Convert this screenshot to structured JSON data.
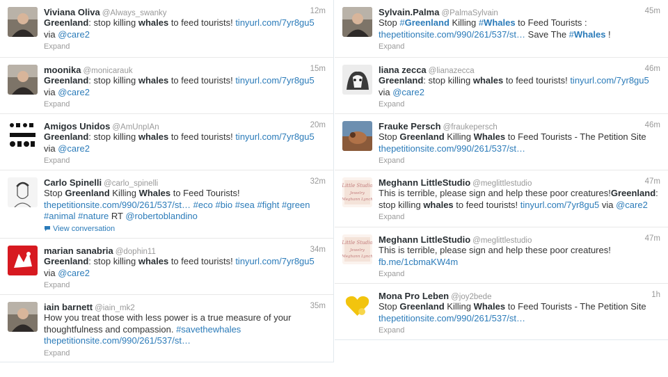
{
  "colors": {
    "link": "#2b7bb9",
    "muted": "#999999",
    "text": "#333333",
    "name": "#292f33",
    "divider": "#e8e8e8"
  },
  "left": [
    {
      "name": "Viviana Oliva",
      "handle": "@Always_swanky",
      "time": "12m",
      "avatar_icon": "photo-person-icon",
      "segments": [
        {
          "t": "Greenland",
          "b": true
        },
        {
          "t": ": stop killing "
        },
        {
          "t": "whales",
          "b": true
        },
        {
          "t": " to feed tourists! "
        },
        {
          "t": "tinyurl.com/7yr8gu5",
          "l": true
        },
        {
          "t": " via "
        },
        {
          "t": "@care2",
          "l": true
        }
      ],
      "action": "Expand"
    },
    {
      "name": "moonika",
      "handle": "@monicarauk",
      "time": "15m",
      "avatar_icon": "photo-person-icon",
      "segments": [
        {
          "t": "Greenland",
          "b": true
        },
        {
          "t": ": stop killing "
        },
        {
          "t": "whales",
          "b": true
        },
        {
          "t": " to feed tourists! "
        },
        {
          "t": "tinyurl.com/7yr8gu5",
          "l": true
        },
        {
          "t": " via "
        },
        {
          "t": "@care2",
          "l": true
        }
      ],
      "action": "Expand"
    },
    {
      "name": "Amigos Unidos",
      "handle": "@AmUnpIAn",
      "time": "20m",
      "avatar_icon": "logo-glyphs-icon",
      "segments": [
        {
          "t": "Greenland",
          "b": true
        },
        {
          "t": ": stop killing "
        },
        {
          "t": "whales",
          "b": true
        },
        {
          "t": " to feed tourists! "
        },
        {
          "t": "tinyurl.com/7yr8gu5",
          "l": true
        },
        {
          "t": " via "
        },
        {
          "t": "@care2",
          "l": true
        }
      ],
      "action": "Expand"
    },
    {
      "name": "Carlo Spinelli",
      "handle": "@carlo_spinelli",
      "time": "32m",
      "avatar_icon": "sketch-face-icon",
      "segments": [
        {
          "t": "Stop "
        },
        {
          "t": "Greenland",
          "b": true
        },
        {
          "t": " Killing "
        },
        {
          "t": "Whales",
          "b": true
        },
        {
          "t": " to Feed Tourists! "
        },
        {
          "t": "thepetitionsite.com/990/261/537/st…",
          "l": true
        },
        {
          "t": " "
        },
        {
          "t": "#eco",
          "l": true
        },
        {
          "t": " "
        },
        {
          "t": "#bio",
          "l": true
        },
        {
          "t": " "
        },
        {
          "t": "#sea",
          "l": true
        },
        {
          "t": " "
        },
        {
          "t": "#fight",
          "l": true
        },
        {
          "t": " "
        },
        {
          "t": "#green",
          "l": true
        },
        {
          "t": " "
        },
        {
          "t": "#animal",
          "l": true
        },
        {
          "t": " "
        },
        {
          "t": "#nature",
          "l": true
        },
        {
          "t": " RT "
        },
        {
          "t": "@robertoblandino",
          "l": true
        }
      ],
      "action": "View conversation",
      "action_link": true
    },
    {
      "name": "marian sanabria",
      "handle": "@dophin11",
      "time": "34m",
      "avatar_icon": "red-logo-icon",
      "segments": [
        {
          "t": "Greenland",
          "b": true
        },
        {
          "t": ": stop killing "
        },
        {
          "t": "whales",
          "b": true
        },
        {
          "t": " to feed tourists! "
        },
        {
          "t": "tinyurl.com/7yr8gu5",
          "l": true
        },
        {
          "t": " via "
        },
        {
          "t": "@care2",
          "l": true
        }
      ],
      "action": "Expand"
    },
    {
      "name": "iain barnett",
      "handle": "@iain_mk2",
      "time": "35m",
      "avatar_icon": "photo-person-icon",
      "segments": [
        {
          "t": "How you treat those with less power is a true measure of your thoughtfulness and compassion. "
        },
        {
          "t": "#savethewhales",
          "l": true
        },
        {
          "t": " "
        },
        {
          "t": "thepetitionsite.com/990/261/537/st…",
          "l": true
        }
      ],
      "action": "Expand"
    }
  ],
  "right": [
    {
      "name": "Sylvain.Palma",
      "handle": "@PalmaSylvain",
      "time": "45m",
      "avatar_icon": "photo-person-icon",
      "segments": [
        {
          "t": "Stop "
        },
        {
          "t": "#",
          "l": true
        },
        {
          "t": "Greenland",
          "l": true,
          "b": true
        },
        {
          "t": " Killing "
        },
        {
          "t": "#",
          "l": true
        },
        {
          "t": "Whales",
          "l": true,
          "b": true
        },
        {
          "t": " to Feed Tourists : "
        },
        {
          "t": "thepetitionsite.com/990/261/537/st…",
          "l": true
        },
        {
          "t": " Save The "
        },
        {
          "t": "#",
          "l": true
        },
        {
          "t": "Whales",
          "l": true,
          "b": true
        },
        {
          "t": " !"
        }
      ],
      "action": "Expand"
    },
    {
      "name": "liana zecca",
      "handle": "@lianazecca",
      "time": "46m",
      "avatar_icon": "photo-dog-icon",
      "segments": [
        {
          "t": "Greenland",
          "b": true
        },
        {
          "t": ": stop killing "
        },
        {
          "t": "whales",
          "b": true
        },
        {
          "t": " to feed tourists! "
        },
        {
          "t": "tinyurl.com/7yr8gu5",
          "l": true
        },
        {
          "t": " via "
        },
        {
          "t": "@care2",
          "l": true
        }
      ],
      "action": "Expand"
    },
    {
      "name": "Frauke Persch",
      "handle": "@fraukepersch",
      "time": "46m",
      "avatar_icon": "photo-animal-icon",
      "segments": [
        {
          "t": "Stop "
        },
        {
          "t": "Greenland",
          "b": true
        },
        {
          "t": " Killing "
        },
        {
          "t": "Whales",
          "b": true
        },
        {
          "t": " to Feed Tourists - The Petition Site "
        },
        {
          "t": "thepetitionsite.com/990/261/537/st…",
          "l": true
        }
      ],
      "action": "Expand"
    },
    {
      "name": "Meghann LittleStudio",
      "handle": "@meglittlestudio",
      "time": "47m",
      "avatar_icon": "studio-logo-icon",
      "avatar_lines": [
        "Little Studio",
        "Jewelry",
        "Meghann Lynch"
      ],
      "segments": [
        {
          "t": "This is terrible, please sign and help these poor creatures!"
        },
        {
          "t": "Greenland",
          "b": true
        },
        {
          "t": ": stop killing "
        },
        {
          "t": "whales",
          "b": true
        },
        {
          "t": " to feed tourists! "
        },
        {
          "t": "tinyurl.com/7yr8gu5",
          "l": true
        },
        {
          "t": " via "
        },
        {
          "t": "@care2",
          "l": true
        }
      ],
      "action": "Expand"
    },
    {
      "name": "Meghann LittleStudio",
      "handle": "@meglittlestudio",
      "time": "47m",
      "avatar_icon": "studio-logo-icon",
      "avatar_lines": [
        "Little Studio",
        "Jewelry",
        "Meghann Lynch"
      ],
      "segments": [
        {
          "t": "This is terrible, please sign and help these poor creatures! "
        },
        {
          "t": "fb.me/1cbmaKW4m",
          "l": true
        }
      ],
      "action": "Expand"
    },
    {
      "name": "Mona Pro Leben",
      "handle": "@joy2bede",
      "time": "1h",
      "avatar_icon": "yellow-heart-icon",
      "segments": [
        {
          "t": "Stop "
        },
        {
          "t": "Greenland",
          "b": true
        },
        {
          "t": " Killing "
        },
        {
          "t": "Whales",
          "b": true
        },
        {
          "t": " to Feed Tourists - The Petition Site "
        },
        {
          "t": "thepetitionsite.com/990/261/537/st…",
          "l": true
        }
      ],
      "action": "Expand"
    }
  ]
}
